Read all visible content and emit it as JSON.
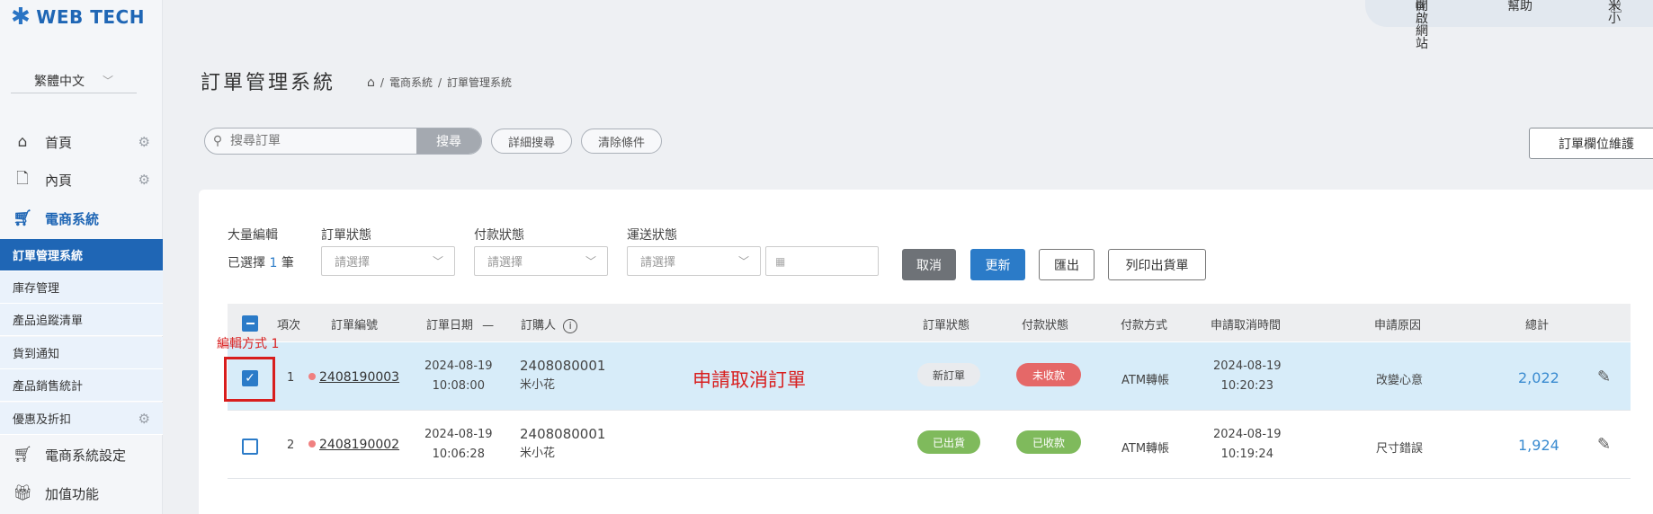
{
  "brand": {
    "name": "WEB TECH",
    "mark": "✱"
  },
  "language": {
    "selected": "繁體中文"
  },
  "sidebar": {
    "items": [
      {
        "label": "首頁",
        "icon": "home-icon"
      },
      {
        "label": "內頁",
        "icon": "page-icon"
      },
      {
        "label": "電商系統",
        "icon": "cart-icon"
      }
    ],
    "sub_items": [
      "訂單管理系統",
      "庫存管理",
      "產品追蹤清單",
      "貨到通知",
      "產品銷售統計",
      "優惠及折扣"
    ],
    "bottom_items": [
      {
        "label": "電商系統設定",
        "icon": "cart-icon"
      },
      {
        "label": "加值功能",
        "icon": "gift-icon"
      }
    ]
  },
  "topbar": {
    "open_site": "開啟網站",
    "help": "幫助",
    "user": "米小"
  },
  "page": {
    "title": "訂單管理系統",
    "breadcrumb": [
      "電商系統",
      "訂單管理系統"
    ]
  },
  "search": {
    "placeholder": "搜尋訂單",
    "button": "搜尋",
    "advanced": "詳細搜尋",
    "clear": "清除條件",
    "field_maintenance": "訂單欄位維護"
  },
  "bulk": {
    "label": "大量編輯",
    "selected_prefix": "已選擇",
    "selected_count": "1",
    "selected_suffix": "筆",
    "order_status_label": "訂單狀態",
    "payment_status_label": "付款狀態",
    "shipping_status_label": "運送狀態",
    "select_placeholder": "請選擇",
    "cancel": "取消",
    "update": "更新",
    "export": "匯出",
    "print": "列印出貨單"
  },
  "table": {
    "headers": [
      "項次",
      "訂單編號",
      "訂單日期",
      "訂購人",
      "訂單狀態",
      "付款狀態",
      "付款方式",
      "申請取消時間",
      "申請原因",
      "總計"
    ],
    "date_sort": "—",
    "rows": [
      {
        "index": "1",
        "order_no": "2408190003",
        "date": "2024-08-19",
        "time": "10:08:00",
        "buyer_id": "2408080001",
        "buyer_name": "米小花",
        "order_status": "新訂單",
        "payment_status": "未收款",
        "payment_method": "ATM轉帳",
        "cancel_date": "2024-08-19",
        "cancel_time": "10:20:23",
        "reason": "改變心意",
        "total": "2,022",
        "checked": true
      },
      {
        "index": "2",
        "order_no": "2408190002",
        "date": "2024-08-19",
        "time": "10:06:28",
        "buyer_id": "2408080001",
        "buyer_name": "米小花",
        "order_status": "已出貨",
        "payment_status": "已收款",
        "payment_method": "ATM轉帳",
        "cancel_date": "2024-08-19",
        "cancel_time": "10:19:24",
        "reason": "尺寸錯誤",
        "total": "1,924",
        "checked": false
      }
    ]
  },
  "annotations": {
    "edit_method": "編輯方式 1",
    "cancel_request": "申請取消訂單"
  },
  "colors": {
    "primary": "#1f66b5",
    "danger": "#e56868",
    "success": "#7fba5c",
    "annotation": "#d81e1e"
  }
}
